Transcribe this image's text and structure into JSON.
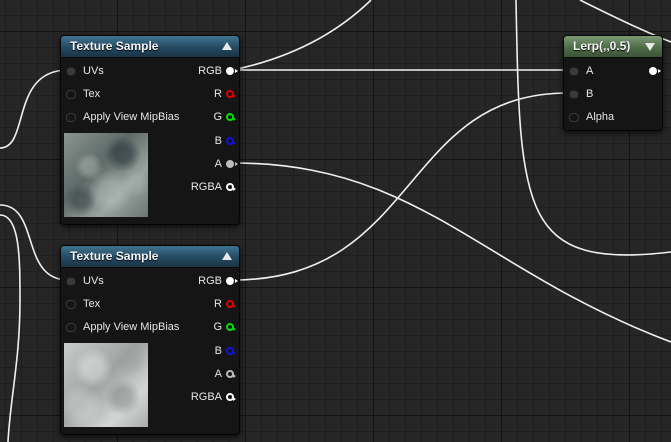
{
  "nodes": {
    "texture_sample_1": {
      "title": "Texture Sample",
      "inputs": [
        "UVs",
        "Tex",
        "Apply View MipBias"
      ],
      "outputs": [
        "RGB",
        "R",
        "G",
        "B",
        "A",
        "RGBA"
      ]
    },
    "texture_sample_2": {
      "title": "Texture Sample",
      "inputs": [
        "UVs",
        "Tex",
        "Apply View MipBias"
      ],
      "outputs": [
        "RGB",
        "R",
        "G",
        "B",
        "A",
        "RGBA"
      ]
    },
    "lerp": {
      "title": "Lerp(,,0.5)",
      "inputs": [
        "A",
        "B",
        "Alpha"
      ]
    }
  },
  "colors": {
    "pin_white": "#ffffff",
    "pin_red": "#ff0000",
    "pin_green": "#00ff00",
    "pin_blue": "#0000ff",
    "pin_gray": "#bdbdbd",
    "wire": "#f0f0f0"
  }
}
